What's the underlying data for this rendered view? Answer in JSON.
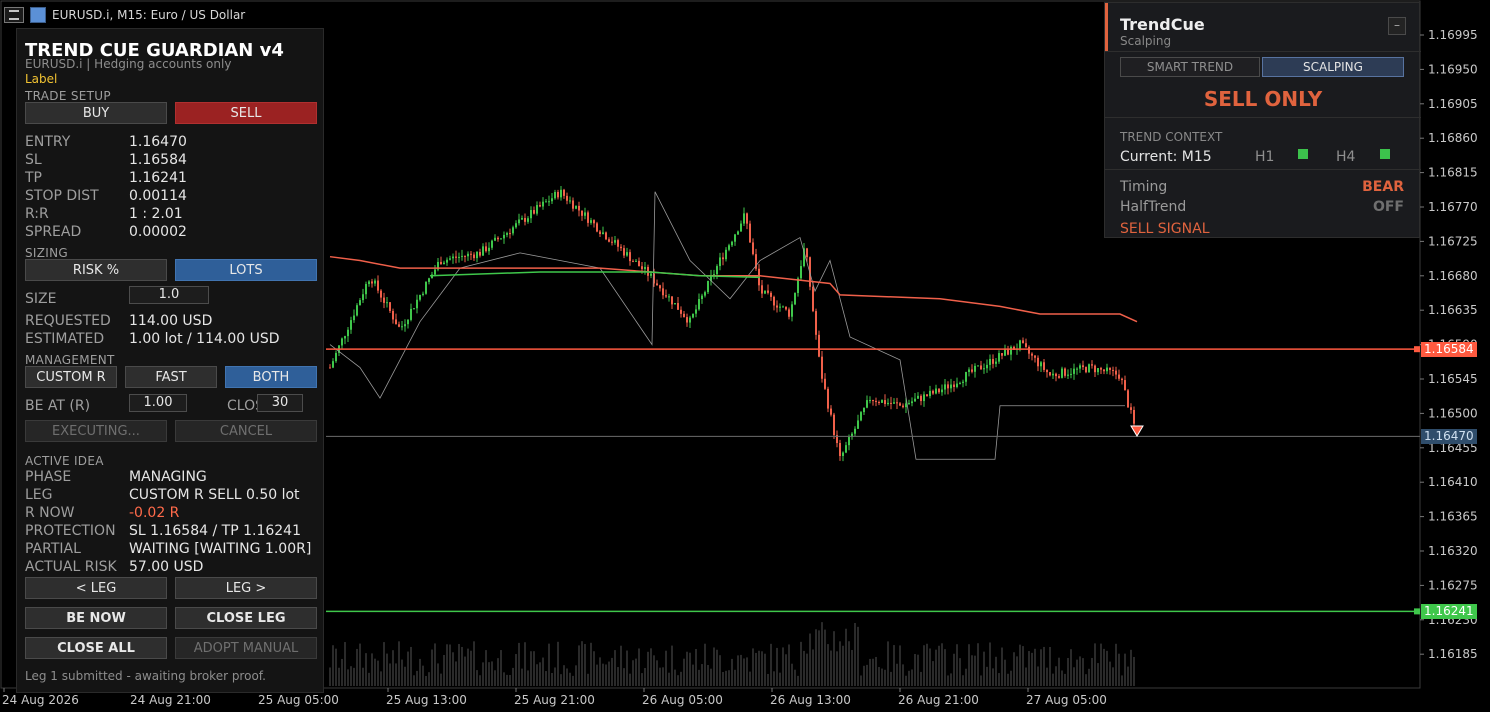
{
  "window": {
    "title": "EURUSD.i, M15:  Euro / US Dollar"
  },
  "panel": {
    "title": "TREND CUE GUARDIAN v4",
    "subtitle": "EURUSD.i  |  Hedging accounts only",
    "label": "Label",
    "trade_setup": {
      "section": "TRADE SETUP",
      "buy": "BUY",
      "sell": "SELL",
      "rows": [
        {
          "k": "ENTRY",
          "v": "1.16470"
        },
        {
          "k": "SL",
          "v": "1.16584"
        },
        {
          "k": "TP",
          "v": "1.16241"
        },
        {
          "k": "STOP DIST",
          "v": "0.00114"
        },
        {
          "k": "R:R",
          "v": "1 : 2.01"
        },
        {
          "k": "SPREAD",
          "v": "0.00002"
        }
      ]
    },
    "sizing": {
      "section": "SIZING",
      "risk_btn": "RISK %",
      "lots_btn": "LOTS",
      "size_label": "SIZE",
      "size_value": "1.0",
      "requested_label": "REQUESTED",
      "requested_value": "114.00 USD",
      "estimated_label": "ESTIMATED",
      "estimated_value": "1.00 lot / 114.00 USD"
    },
    "management": {
      "section": "MANAGEMENT",
      "custom_btn": "CUSTOM R",
      "fast_btn": "FAST",
      "both_btn": "BOTH",
      "be_label": "BE AT (R)",
      "be_value": "1.00",
      "close_label": "CLOSE %",
      "close_value": "30",
      "executing_btn": "EXECUTING...",
      "cancel_btn": "CANCEL"
    },
    "active_idea": {
      "section": "ACTIVE IDEA",
      "rows": [
        {
          "k": "PHASE",
          "v": "MANAGING"
        },
        {
          "k": "LEG",
          "v": "CUSTOM R  SELL  0.50 lot"
        },
        {
          "k": "R NOW",
          "v": "-0.02 R"
        },
        {
          "k": "PROTECTION",
          "v": "SL 1.16584 / TP 1.16241"
        },
        {
          "k": "PARTIAL",
          "v": "WAITING  [WAITING 1.00R]"
        },
        {
          "k": "ACTUAL RISK",
          "v": "57.00 USD"
        }
      ],
      "prev_leg": "< LEG",
      "next_leg": "LEG >",
      "be_now": "BE NOW",
      "close_leg": "CLOSE LEG",
      "close_all": "CLOSE ALL",
      "adopt_manual": "ADOPT MANUAL"
    },
    "footer": "Leg 1 submitted - awaiting broker proof."
  },
  "trendcue": {
    "title": "TrendCue",
    "subtitle": "Scalping",
    "minimize": "–",
    "tab_smart": "SMART TREND",
    "tab_scalping": "SCALPING",
    "signal_big": "SELL ONLY",
    "context_section": "TREND CONTEXT",
    "current": "Current: M15",
    "h1": "H1",
    "h4": "H4",
    "timing_label": "Timing",
    "timing_value": "BEAR",
    "halftrend_label": "HalfTrend",
    "halftrend_value": "OFF",
    "signal_text": "SELL SIGNAL",
    "colors": {
      "bear": "#e0633e",
      "off": "#6f6f6f",
      "bull_square": "#3cc24c"
    }
  },
  "chart": {
    "price_ticks": [
      "1.16995",
      "1.16950",
      "1.16905",
      "1.16860",
      "1.16815",
      "1.16770",
      "1.16725",
      "1.16680",
      "1.16635",
      "1.16590",
      "1.16545",
      "1.16500",
      "1.16455",
      "1.16410",
      "1.16365",
      "1.16320",
      "1.16275",
      "1.16230",
      "1.16185"
    ],
    "time_ticks": [
      "24 Aug 2026",
      "24 Aug 21:00",
      "25 Aug 05:00",
      "25 Aug 13:00",
      "25 Aug 21:00",
      "26 Aug 05:00",
      "26 Aug 13:00",
      "26 Aug 21:00",
      "27 Aug 05:00"
    ],
    "sl_tag": "1.16584",
    "entry_tag": "1.16470",
    "tp_tag": "1.16241",
    "colors": {
      "bull": "#3fc74b",
      "bear": "#f0604a",
      "sl_line": "#ff5a40",
      "tp_line": "#3fc74b",
      "entry_line": "#6b6b6b",
      "grid": "#1f1f1f"
    }
  }
}
